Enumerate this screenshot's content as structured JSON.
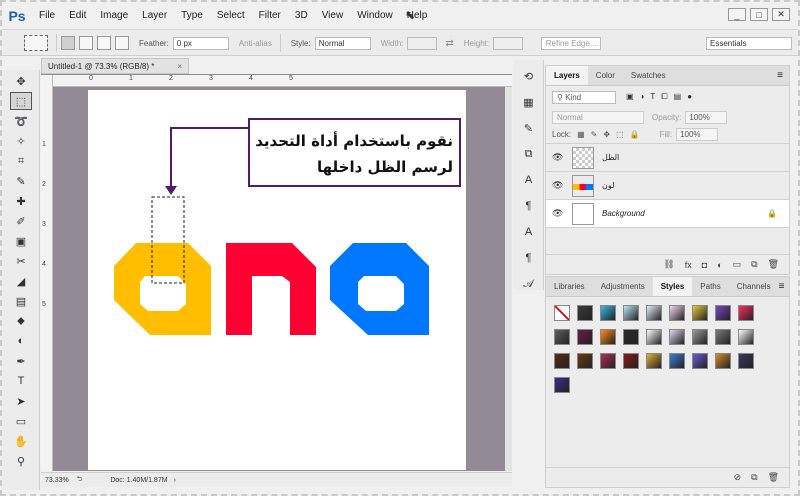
{
  "app": {
    "logo": "Ps",
    "menu": [
      "File",
      "Edit",
      "Image",
      "Layer",
      "Type",
      "Select",
      "Filter",
      "3D",
      "View",
      "Window",
      "Help"
    ],
    "window_controls": [
      "_",
      "□",
      "✕"
    ]
  },
  "options": {
    "feather_label": "Feather:",
    "feather_value": "0 px",
    "antialias_label": "Anti-alias",
    "style_label": "Style:",
    "style_value": "Normal",
    "width_label": "Width:",
    "height_label": "Height:",
    "refine_edge": "Refine Edge...",
    "workspace": "Essentials"
  },
  "document": {
    "tab_title": "Untitled-1 @ 73.3% (RGB/8) *",
    "close": "×",
    "ruler_h": [
      "0",
      "1",
      "2",
      "3",
      "4",
      "5"
    ],
    "ruler_v": [
      "1",
      "2",
      "3",
      "4",
      "5"
    ],
    "zoom": "73.33%",
    "doc_info": "Doc: 1.40M/1.87M"
  },
  "annotation": {
    "line1": "نقوم باستخدام أداة التحديد",
    "line2": "لرسم الظل داخلها"
  },
  "layers_panel": {
    "tabs": [
      "Layers",
      "Color",
      "Swatches"
    ],
    "kind": "Kind",
    "blend": "Normal",
    "opacity_label": "Opacity:",
    "opacity_value": "100%",
    "lock_label": "Lock:",
    "fill_label": "Fill:",
    "fill_value": "100%",
    "layers": [
      {
        "name": "الظل"
      },
      {
        "name": "لون"
      },
      {
        "name": "Background"
      }
    ]
  },
  "styles_panel": {
    "tabs": [
      "Libraries",
      "Adjustments",
      "Styles",
      "Paths",
      "Channels"
    ]
  },
  "colors": {
    "yellow": "#ffbf00",
    "red": "#ff0033",
    "blue": "#0077ff",
    "callout_border": "#4e1b6d",
    "canvas_bg": "#928b95"
  },
  "styles_swatches": [
    "#ffffff",
    "#3a3a3a",
    "#3bb7e6",
    "#b9e8f7",
    "#dff0f7",
    "#f4d6f0",
    "#e8c83a",
    "#7b45c4",
    "#ff2e5a",
    "#606060",
    "#6f1a4a",
    "#ff8c1a",
    "#2a2a2a",
    "#ffffff",
    "#e0d7ef",
    "#9b9b9b",
    "#7a7a7a",
    "#ffffff",
    "#5a2a0e",
    "#6a3a14",
    "#b02f56",
    "#8a1a1a",
    "#e0b13a",
    "#3c7dd8",
    "#6a5ad8",
    "#d98a2b",
    "#343a66",
    "#3b2e8a"
  ]
}
